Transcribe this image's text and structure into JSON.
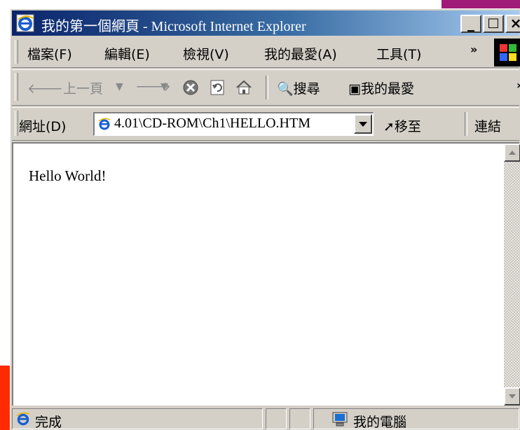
{
  "window": {
    "title": "我的第一個網頁 - Microsoft Internet Explorer",
    "controls": {
      "minimize": "_",
      "maximize": "□",
      "close": "×"
    }
  },
  "menubar": {
    "items": [
      "檔案(F)",
      "編輯(E)",
      "檢視(V)",
      "我的最愛(A)",
      "工具(T)"
    ],
    "overflow": "»"
  },
  "toolbar": {
    "back_label": "上一頁",
    "search_label": "搜尋",
    "favorites_label": "我的最愛"
  },
  "address": {
    "label": "網址(D)",
    "value": "4.01\\CD-ROM\\Ch1\\HELLO.HTM",
    "go_label": "移至",
    "links_label": "連結"
  },
  "content": {
    "text": "Hello World!"
  },
  "status": {
    "text": "完成",
    "zone": "我的電腦"
  },
  "colors": {
    "title_start": "#0a246a",
    "title_end": "#a6caf0",
    "chrome": "#d4d0c8"
  }
}
